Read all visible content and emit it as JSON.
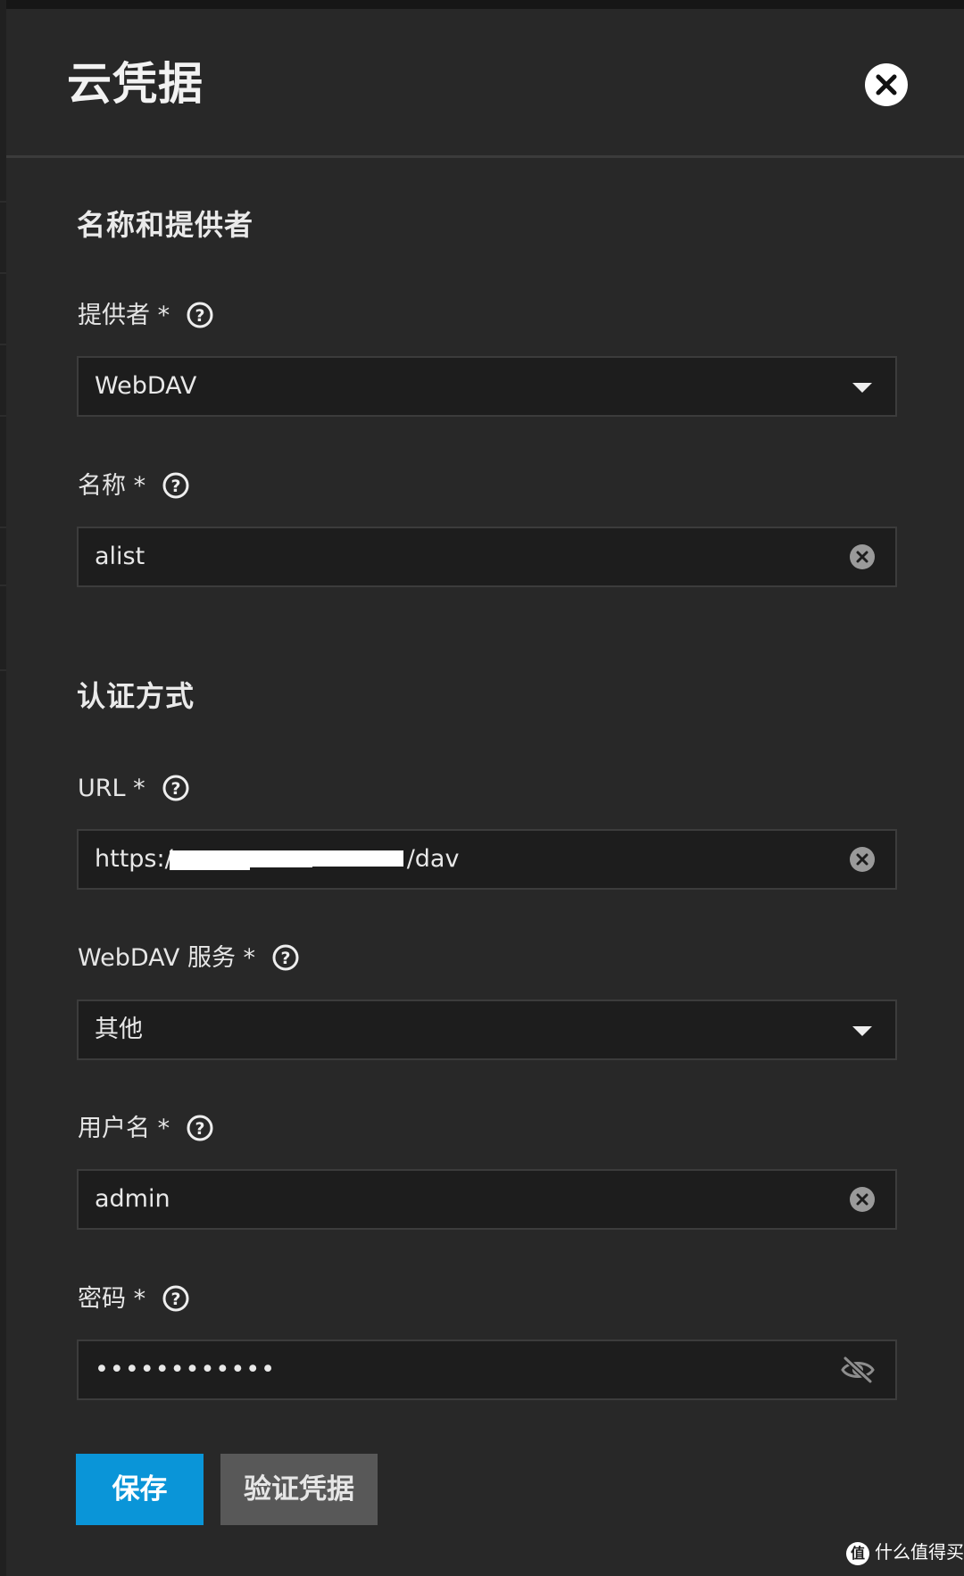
{
  "dialog": {
    "title": "云凭据"
  },
  "section_name_provider": {
    "title": "名称和提供者",
    "provider": {
      "label": "提供者 *",
      "value": "WebDAV"
    },
    "name": {
      "label": "名称 *",
      "value": "alist"
    }
  },
  "section_auth": {
    "title": "认证方式",
    "url": {
      "label": "URL *",
      "value_prefix": "https:/",
      "value_suffix": "/dav"
    },
    "webdav_service": {
      "label": "WebDAV 服务 *",
      "value": "其他"
    },
    "username": {
      "label": "用户名 *",
      "value": "admin"
    },
    "password": {
      "label": "密码 *",
      "value": "••••••••••••"
    }
  },
  "actions": {
    "save_label": "保存",
    "verify_label": "验证凭据"
  },
  "watermark": {
    "logo": "值",
    "text": "什么值得买"
  },
  "icons": {
    "close": "close-icon",
    "help": "help-circle-icon",
    "clear": "clear-circle-icon",
    "visibility": "visibility-off-icon",
    "dropdown": "chevron-down-icon"
  },
  "colors": {
    "panel_bg": "#282828",
    "input_bg": "#1d1d1d",
    "primary_button": "#0a95d8",
    "secondary_button": "#585858"
  }
}
